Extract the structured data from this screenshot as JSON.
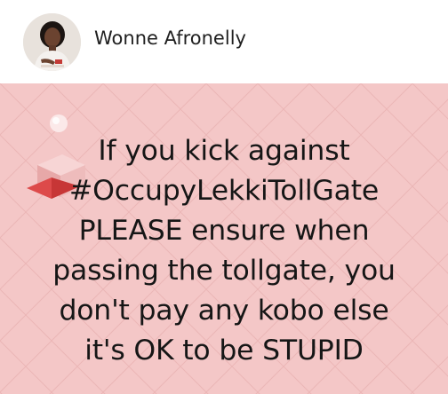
{
  "author": {
    "name": "Wonne Afronelly",
    "avatar_icon": "profile-photo"
  },
  "post": {
    "lines": [
      "If you kick against",
      "#OccupyLekkiTollGate",
      "PLEASE ensure when",
      "passing the tollgate, you",
      "don't pay any kobo else",
      "it's OK to be STUPID"
    ],
    "background_color": "#f4c7c7",
    "text_color": "#161616"
  }
}
